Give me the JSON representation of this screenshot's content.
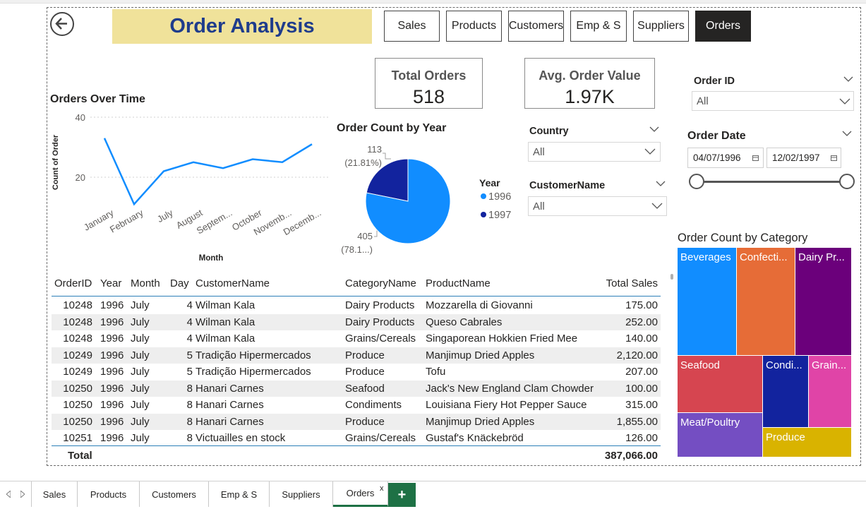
{
  "header": {
    "title": "Order Analysis",
    "title_bg": "#f0e29a",
    "title_color": "#1f3c8c",
    "nav": [
      {
        "label": "Sales",
        "active": false
      },
      {
        "label": "Products",
        "active": false
      },
      {
        "label": "Customers",
        "active": false
      },
      {
        "label": "Emp & S",
        "active": false
      },
      {
        "label": "Suppliers",
        "active": false
      },
      {
        "label": "Orders",
        "active": true
      }
    ],
    "nav_active_bg": "#252423"
  },
  "cards": {
    "total_orders": {
      "label": "Total Orders",
      "value": "518"
    },
    "avg_order_value": {
      "label": "Avg. Order Value",
      "value": "1.97K"
    }
  },
  "line_chart": {
    "title": "Orders Over Time",
    "ylabel": "Count of Order",
    "xlabel": "Month",
    "y_ticks": [
      "40",
      "20"
    ]
  },
  "pie_chart": {
    "title": "Order Count by Year",
    "legend_title": "Year",
    "label_1997": {
      "count": "113",
      "pct": "(21.81%)"
    },
    "label_1996": {
      "count": "405",
      "pct": "(78.1...)"
    }
  },
  "chart_data": [
    {
      "type": "line",
      "title": "Orders Over Time",
      "xlabel": "Month",
      "ylabel": "Count of Order",
      "categories": [
        "January",
        "February",
        "July",
        "August",
        "Septem...",
        "October",
        "Novemb...",
        "Decemb..."
      ],
      "series": [
        {
          "values": [
            33,
            11,
            22,
            25,
            23,
            26,
            25,
            31
          ]
        }
      ],
      "ylim": [
        0,
        40
      ],
      "y_ticks": [
        20,
        40
      ],
      "color": "#118dff",
      "grid": true
    },
    {
      "type": "pie",
      "title": "Order Count by Year",
      "legend_title": "Year",
      "categories": [
        "1996",
        "1997"
      ],
      "values": [
        405,
        113
      ],
      "colors": [
        "#118dff",
        "#12239e"
      ],
      "legend_position": "right"
    },
    {
      "type": "treemap",
      "title": "Order Count by Category",
      "categories": [
        "Beverages",
        "Confecti...",
        "Dairy Pr...",
        "Seafood",
        "Condi...",
        "Grain...",
        "Meat/Poultry",
        "Produce"
      ],
      "colors": [
        "#118dff",
        "#e66c37",
        "#6b007b",
        "#d64550",
        "#12239e",
        "#e044a7",
        "#744ec2",
        "#d9b300"
      ]
    }
  ],
  "slicers": {
    "order_id": {
      "title": "Order ID",
      "value": "All"
    },
    "order_date": {
      "title": "Order Date",
      "start": "04/07/1996",
      "end": "12/02/1997"
    },
    "country": {
      "title": "Country",
      "value": "All"
    },
    "customer_name": {
      "title": "CustomerName",
      "value": "All"
    }
  },
  "treemap": {
    "title": "Order Count by Category"
  },
  "table": {
    "columns": [
      "OrderID",
      "Year",
      "Month",
      "Day",
      "CustomerName",
      "CategoryName",
      "ProductName",
      "Total Sales"
    ],
    "rows": [
      [
        "10248",
        "1996",
        "July",
        "4",
        "Wilman Kala",
        "Dairy Products",
        "Mozzarella di Giovanni",
        "175.00"
      ],
      [
        "10248",
        "1996",
        "July",
        "4",
        "Wilman Kala",
        "Dairy Products",
        "Queso Cabrales",
        "252.00"
      ],
      [
        "10248",
        "1996",
        "July",
        "4",
        "Wilman Kala",
        "Grains/Cereals",
        "Singaporean Hokkien Fried Mee",
        "140.00"
      ],
      [
        "10249",
        "1996",
        "July",
        "5",
        "Tradição Hipermercados",
        "Produce",
        "Manjimup Dried Apples",
        "2,120.00"
      ],
      [
        "10249",
        "1996",
        "July",
        "5",
        "Tradição Hipermercados",
        "Produce",
        "Tofu",
        "207.00"
      ],
      [
        "10250",
        "1996",
        "July",
        "8",
        "Hanari Carnes",
        "Seafood",
        "Jack's New England Clam Chowder",
        "100.00"
      ],
      [
        "10250",
        "1996",
        "July",
        "8",
        "Hanari Carnes",
        "Condiments",
        "Louisiana Fiery Hot Pepper Sauce",
        "315.00"
      ],
      [
        "10250",
        "1996",
        "July",
        "8",
        "Hanari Carnes",
        "Produce",
        "Manjimup Dried Apples",
        "1,855.00"
      ],
      [
        "10251",
        "1996",
        "July",
        "8",
        "Victuailles en stock",
        "Grains/Cereals",
        "Gustaf's Knäckebröd",
        "126.00"
      ]
    ],
    "total_label": "Total",
    "total_value": "387,066.00",
    "header_line_color": "#2c7fb8"
  },
  "tabs": {
    "items": [
      "Sales",
      "Products",
      "Customers",
      "Emp & S",
      "Suppliers",
      "Orders"
    ],
    "active": "Orders",
    "close_glyph": "x",
    "add_glyph": "+",
    "add_bg": "#1e7145"
  }
}
